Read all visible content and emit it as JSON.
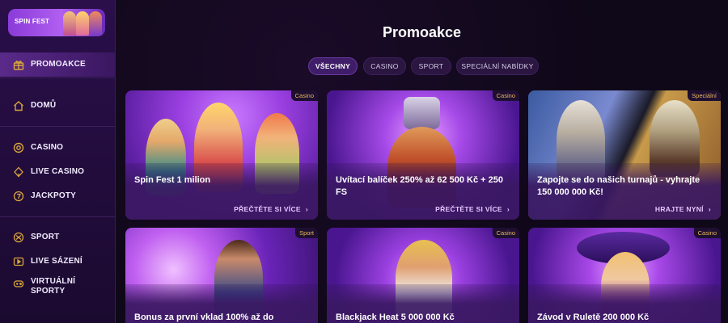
{
  "brand": {
    "name": "SPIN FEST"
  },
  "sidebar": {
    "items": [
      {
        "label": "PROMOAKCE",
        "icon": "gift-icon",
        "active": true
      },
      {
        "label": "DOMŮ",
        "icon": "home-icon"
      },
      {
        "label": "CASINO",
        "icon": "casino-chip-icon"
      },
      {
        "label": "LIVE CASINO",
        "icon": "clubs-icon"
      },
      {
        "label": "JACKPOTY",
        "icon": "seven-icon"
      },
      {
        "label": "SPORT",
        "icon": "ball-icon"
      },
      {
        "label": "LIVE SÁZENÍ",
        "icon": "play-icon"
      },
      {
        "label": "VIRTUÁLNÍ SPORTY",
        "icon": "gamepad-icon"
      }
    ]
  },
  "main": {
    "title": "Promoakce",
    "filters": [
      {
        "label": "VŠECHNY",
        "active": true
      },
      {
        "label": "CASINO"
      },
      {
        "label": "SPORT"
      },
      {
        "label": "SPECIÁLNÍ NABÍDKY"
      }
    ],
    "cards": [
      {
        "badge": "Casino",
        "title": "Spin Fest 1 milion",
        "link": "PŘEČTĚTE SI VÍCE"
      },
      {
        "badge": "Casino",
        "title": "Uvítací balíček 250% až 62 500 Kč + 250 FS",
        "link": "PŘEČTĚTE SI VÍCE"
      },
      {
        "badge": "Speciální",
        "title": "Zapojte se do našich turnajů - vyhrajte 150 000 000 Kč!",
        "link": "HRAJTE NYNÍ"
      },
      {
        "badge": "Sport",
        "title": "Bonus za první vklad 100% až do"
      },
      {
        "badge": "Casino",
        "title": "Blackjack Heat 5 000 000 Kč"
      },
      {
        "badge": "Casino",
        "title": "Závod v Ruletě 200 000 Kč"
      }
    ]
  },
  "colors": {
    "accent": "#d9a63a",
    "active_bg": "#3f1d68",
    "card_bg": "#3a1862"
  }
}
